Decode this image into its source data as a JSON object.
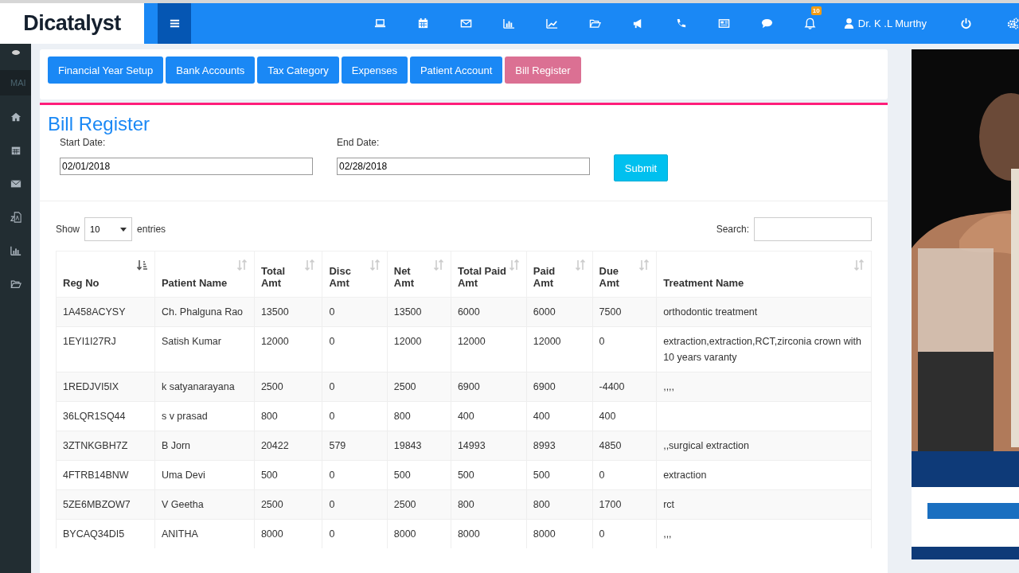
{
  "header": {
    "logo": "Dicatalyst",
    "notification_count": "10",
    "user_name": "Dr. K .L Murthy"
  },
  "sidebar": {
    "section_label": "MAI"
  },
  "tabs": [
    {
      "label": "Financial Year Setup",
      "selected": false
    },
    {
      "label": "Bank Accounts",
      "selected": false
    },
    {
      "label": "Tax Category",
      "selected": false
    },
    {
      "label": "Expenses",
      "selected": false
    },
    {
      "label": "Patient Account",
      "selected": false
    },
    {
      "label": "Bill Register",
      "selected": true
    }
  ],
  "page_title": "Bill Register",
  "filters": {
    "start_label": "Start Date:",
    "start_value": "02/01/2018",
    "end_label": "End Date:",
    "end_value": "02/28/2018",
    "submit": "Submit"
  },
  "table_controls": {
    "show_label": "Show",
    "page_size": "10",
    "entries_label": "entries",
    "search_label": "Search:"
  },
  "table": {
    "columns": [
      {
        "label": "Reg No",
        "sorted": true
      },
      {
        "label": "Patient Name",
        "sorted": false
      },
      {
        "label": "Total Amt",
        "sorted": false
      },
      {
        "label": "Disc Amt",
        "sorted": false
      },
      {
        "label": "Net Amt",
        "sorted": false
      },
      {
        "label": "Total Paid Amt",
        "sorted": false
      },
      {
        "label": "Paid Amt",
        "sorted": false
      },
      {
        "label": "Due Amt",
        "sorted": false
      },
      {
        "label": "Treatment Name",
        "sorted": false
      }
    ],
    "rows": [
      [
        "1A458ACYSY",
        "Ch. Phalguna Rao",
        "13500",
        "0",
        "13500",
        "6000",
        "6000",
        "7500",
        "orthodontic treatment"
      ],
      [
        "1EYI1I27RJ",
        "Satish Kumar",
        "12000",
        "0",
        "12000",
        "12000",
        "12000",
        "0",
        "extraction,extraction,RCT,zirconia crown with 10 years varanty"
      ],
      [
        "1REDJVI5IX",
        "k satyanarayana",
        "2500",
        "0",
        "2500",
        "6900",
        "6900",
        "-4400",
        ",,,,"
      ],
      [
        "36LQR1SQ44",
        "s v prasad",
        "800",
        "0",
        "800",
        "400",
        "400",
        "400",
        ""
      ],
      [
        "3ZTNKGBH7Z",
        "B Jorn",
        "20422",
        "579",
        "19843",
        "14993",
        "8993",
        "4850",
        ",,surgical extraction"
      ],
      [
        "4FTRB14BNW",
        "Uma Devi",
        "500",
        "0",
        "500",
        "500",
        "500",
        "0",
        "extraction"
      ],
      [
        "5ZE6MBZOW7",
        "V Geetha",
        "2500",
        "0",
        "2500",
        "800",
        "800",
        "1700",
        "rct"
      ],
      [
        "BYCAQ34DI5",
        "ANITHA",
        "8000",
        "0",
        "8000",
        "8000",
        "8000",
        "0",
        ",,,"
      ]
    ]
  }
}
